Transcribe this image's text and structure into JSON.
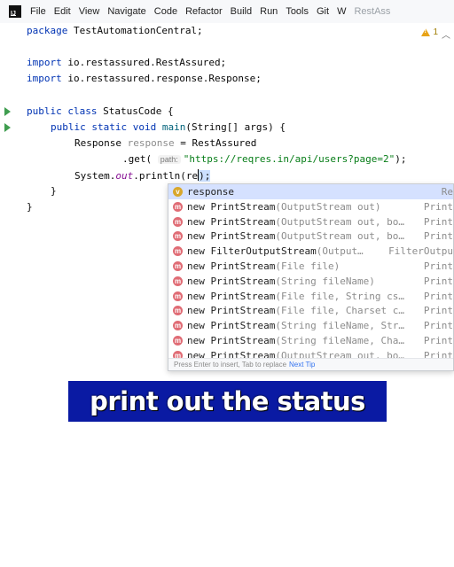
{
  "menubar": {
    "items": [
      "File",
      "Edit",
      "View",
      "Navigate",
      "Code",
      "Refactor",
      "Build",
      "Run",
      "Tools",
      "Git",
      "W"
    ],
    "tab_title": "RestAss"
  },
  "editor": {
    "warnings_count": "1",
    "lines": {
      "package": [
        "package",
        "TestAutomationCentral;"
      ],
      "import1": [
        "import",
        "io.restassured.RestAssured;"
      ],
      "import2": [
        "import",
        "io.restassured.response.Response;"
      ],
      "class_decl": [
        "public",
        "class",
        "StatusCode {"
      ],
      "main_decl": [
        "public",
        "static",
        "void",
        "main",
        "(String[] args) {"
      ],
      "response_decl": [
        "Response",
        "response",
        "= RestAssured"
      ],
      "get_call": [
        ".get(",
        "path:",
        "\"https://reqres.in/api/users?page=2\"",
        ");"
      ],
      "println": [
        "System.",
        "out",
        ".println(",
        "re",
        ");"
      ],
      "close1": "}",
      "close2": "}"
    }
  },
  "completion": {
    "items": [
      {
        "icon": "variable",
        "text": "response",
        "params": "",
        "type": "Re"
      },
      {
        "icon": "method",
        "text": "new PrintStream",
        "params": "(OutputStream out)",
        "type": "Print"
      },
      {
        "icon": "method",
        "text": "new PrintStream",
        "params": "(OutputStream out, bo…",
        "type": "Print"
      },
      {
        "icon": "method",
        "text": "new PrintStream",
        "params": "(OutputStream out, bo…",
        "type": "Print"
      },
      {
        "icon": "method",
        "text": "new FilterOutputStream",
        "params": "(Output…",
        "type": "FilterOutpu"
      },
      {
        "icon": "method",
        "text": "new PrintStream",
        "params": "(File file)",
        "type": "Print"
      },
      {
        "icon": "method",
        "text": "new PrintStream",
        "params": "(String fileName)",
        "type": "Print"
      },
      {
        "icon": "method",
        "text": "new PrintStream",
        "params": "(File file, String cs…",
        "type": "Print"
      },
      {
        "icon": "method",
        "text": "new PrintStream",
        "params": "(File file, Charset c…",
        "type": "Print"
      },
      {
        "icon": "method",
        "text": "new PrintStream",
        "params": "(String fileName, Str…",
        "type": "Print"
      },
      {
        "icon": "method",
        "text": "new PrintStream",
        "params": "(String fileName, Cha…",
        "type": "Print"
      },
      {
        "icon": "method",
        "text": "new PrintStream",
        "params": "(OutputStream out, bo…",
        "type": "Print"
      }
    ],
    "icon_letters": {
      "variable": "v",
      "method": "m"
    },
    "footer": {
      "text": "Press Enter to insert, Tab to replace",
      "link": "Next Tip"
    }
  },
  "caption": {
    "text": "print out the status"
  },
  "colors": {
    "caption_bg": "#0a1aa3",
    "keyword": "#0033b3",
    "string": "#067d17",
    "selection": "#d5e1ff"
  }
}
